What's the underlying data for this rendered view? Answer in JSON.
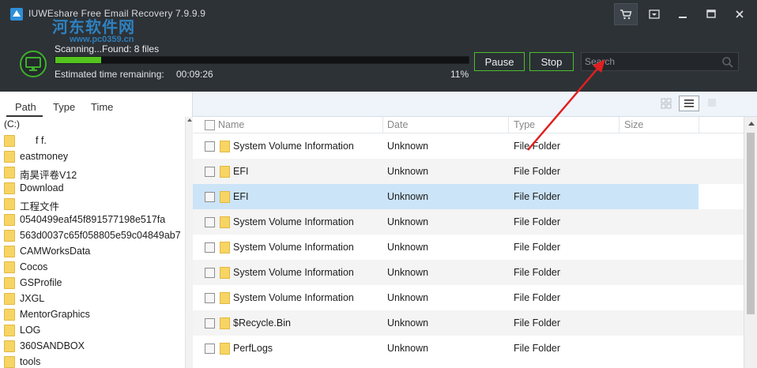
{
  "app": {
    "title": "IUWEshare Free Email Recovery 7.9.9.9",
    "watermark": "河东软件网",
    "watermark_url": "www.pc0359.cn"
  },
  "titlebar": {
    "icons": [
      "cart-icon",
      "menu-dropdown-icon",
      "minimize-icon",
      "maximize-icon",
      "close-icon"
    ]
  },
  "scan": {
    "status": "Scanning...Found: 8 files",
    "time_label": "Estimated time remaining:",
    "time_value": "00:09:26",
    "percent_text": "11%",
    "progress_fraction": 0.11
  },
  "buttons": {
    "pause": "Pause",
    "stop": "Stop"
  },
  "search": {
    "placeholder": "Search"
  },
  "tabs": {
    "path": "Path",
    "type": "Type",
    "time": "Time"
  },
  "tree": {
    "root": "(C:)",
    "items": [
      "f f.",
      "eastmoney",
      "南昊评卷V12",
      "Download",
      "工程文件",
      "0540499eaf45f891577198e517fa",
      "563d0037c65f058805e59c04849ab7",
      "CAMWorksData",
      "Cocos",
      "GSProfile",
      "JXGL",
      "MentorGraphics",
      "LOG",
      "360SANDBOX",
      "tools"
    ]
  },
  "table": {
    "headers": {
      "name": "Name",
      "date": "Date",
      "type": "Type",
      "size": "Size"
    },
    "rows": [
      {
        "name": "System Volume Information",
        "date": "Unknown",
        "type": "File Folder"
      },
      {
        "name": "EFI",
        "date": "Unknown",
        "type": "File Folder"
      },
      {
        "name": "EFI",
        "date": "Unknown",
        "type": "File Folder"
      },
      {
        "name": "System Volume Information",
        "date": "Unknown",
        "type": "File Folder"
      },
      {
        "name": "System Volume Information",
        "date": "Unknown",
        "type": "File Folder"
      },
      {
        "name": "System Volume Information",
        "date": "Unknown",
        "type": "File Folder"
      },
      {
        "name": "System Volume Information",
        "date": "Unknown",
        "type": "File Folder"
      },
      {
        "name": "$Recycle.Bin",
        "date": "Unknown",
        "type": "File Folder"
      },
      {
        "name": "PerfLogs",
        "date": "Unknown",
        "type": "File Folder"
      }
    ],
    "selected_row": 2
  },
  "colors": {
    "header_bg": "#2d3237",
    "accent_green": "#54c41f",
    "selection": "#cce4f7",
    "annotation_red": "#e02020"
  }
}
